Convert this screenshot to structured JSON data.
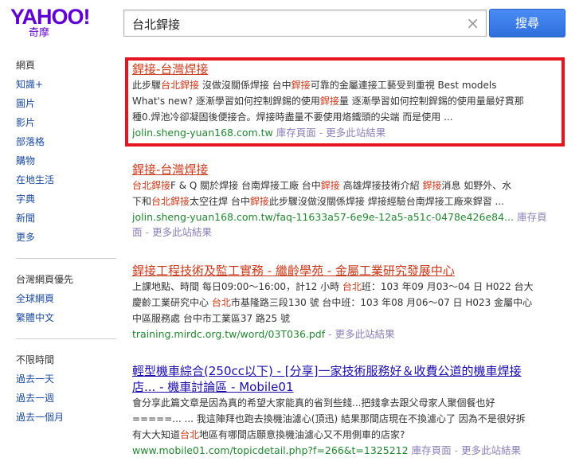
{
  "logo": {
    "main": "YAHOO!",
    "sub": "奇摩"
  },
  "search": {
    "query": "台北銲接",
    "clear": "×",
    "button": "搜尋"
  },
  "sidebar": {
    "groups": [
      [
        "網頁",
        "知識+",
        "圖片",
        "影片",
        "部落格",
        "購物",
        "在地生活",
        "字典",
        "新聞",
        "更多"
      ],
      [
        "台灣網頁優先",
        "全球網頁",
        "繁體中文"
      ],
      [
        "不限時間",
        "過去一天",
        "過去一週",
        "過去一個月"
      ]
    ]
  },
  "results": [
    {
      "title": "銲接-台灣焊接",
      "desc": [
        [
          [
            "此步驟",
            0
          ],
          [
            "台北銲接",
            1
          ],
          [
            " 沒做沒關係焊接 台中",
            0
          ],
          [
            "銲接",
            1
          ],
          [
            "可靠的金屬連接工藝受到重視 Best models",
            0
          ]
        ],
        [
          [
            "What's new? 逐漸學習如何控制銲錫的使用",
            0
          ],
          [
            "銲接",
            1
          ],
          [
            "量 逐漸學習如何控制銲錫的使用量最好貫那",
            0
          ]
        ],
        [
          [
            "種0.焊池冷卻凝固後便接合。焊接時盡量不要使用烙鐵頭的尖端 而是使用 ...",
            0
          ]
        ]
      ],
      "url": "jolin.sheng-yuan168.com.tw",
      "cache": "庫存頁面",
      "dash": "-",
      "more": "更多此站結果"
    },
    {
      "title": "銲接-台灣焊接",
      "desc": [
        [
          [
            "台北銲接",
            1
          ],
          [
            "F & Q 關於焊接 台南焊接工廠 台中",
            0
          ],
          [
            "銲接",
            1
          ],
          [
            " 高雄焊接技術介紹 ",
            0
          ],
          [
            "銲接",
            1
          ],
          [
            "消息 如野外、水",
            0
          ]
        ],
        [
          [
            "下和",
            0
          ],
          [
            "台北銲接",
            1
          ],
          [
            "太空往焊 台中",
            0
          ],
          [
            "銲接",
            1
          ],
          [
            "此步驟沒做沒關係焊接 焊接經驗台南焊接工廠來銲習 ...",
            0
          ]
        ]
      ],
      "url": "jolin.sheng-yuan168.com.tw/faq-11633a57-6e9e-12a5-a51c-0478e426e84...",
      "cache": "庫存頁面",
      "dash": "-",
      "more": "更多此站結果"
    },
    {
      "title": "銲接工程技術及監工實務 - 繼齡學苑 - 金屬工業研究發展中心",
      "desc": [
        [
          [
            "上課地點、時間 每日09:00～16:00，計12 小時 ",
            0
          ],
          [
            "台北",
            1
          ],
          [
            "班：103 年09 月03～04 日 H022 台大",
            0
          ]
        ],
        [
          [
            "慶齡工業研究中心 ",
            0
          ],
          [
            "台北",
            1
          ],
          [
            "市基隆路三段130 號 台中班：103 年08 月06～07 日 H023 金屬中心",
            0
          ]
        ],
        [
          [
            "中區服務處 台中市工業區37 路25 號",
            0
          ]
        ]
      ],
      "url": "training.mirdc.org.tw/word/03T036.pdf",
      "cache": "",
      "dash": "-",
      "more": "更多此站結果"
    },
    {
      "title_lines": [
        "輕型機車綜合(250cc以下) - [分享]一家技術服務好＆收費公道的機車焊接",
        "店... - 機車討論區 - Mobile01"
      ],
      "desc": [
        [
          [
            "會分享此篇文章是因為真的希望大家能真的省到些錢...把錢拿去跟父母家人聚個餐也好",
            0
          ]
        ],
        [
          [
            "=====... ... 我這陣拜也跑去換機油濾心(頂迅) 結果那間店現在不換濾心了 因為不是很好拆",
            0
          ]
        ],
        [
          [
            "有大大知道",
            0
          ],
          [
            "台北",
            1
          ],
          [
            "地區有哪間店願意換機油濾心又不用側車的店家?",
            0
          ]
        ]
      ],
      "url": "www.mobile01.com/topicdetail.php?f=266&t=1325212",
      "cache": "庫存頁面",
      "dash": "-",
      "more": "更多此站結果"
    }
  ],
  "colors": {
    "accent": "#5f01d1",
    "highlight_box": "#e51421",
    "link_red": "#c8391a",
    "link_blue": "#1a0dab",
    "url_green": "#238631"
  }
}
